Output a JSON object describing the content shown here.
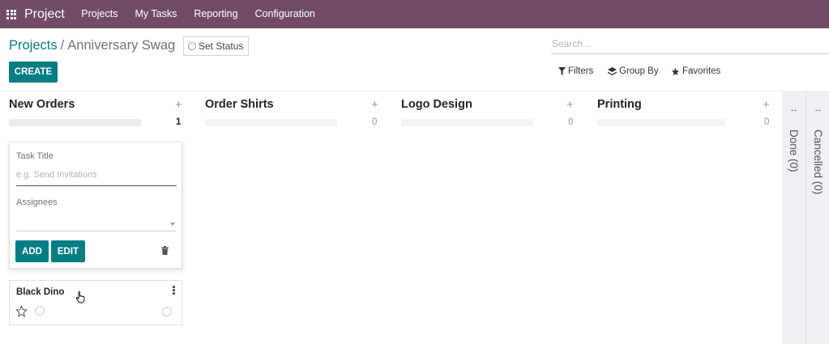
{
  "topbar": {
    "apps_icon": "grid-icon",
    "brand": "Project",
    "menu": [
      "Projects",
      "My Tasks",
      "Reporting",
      "Configuration"
    ]
  },
  "breadcrumb": {
    "parent": "Projects",
    "separator": "/",
    "current": "Anniversary Swag"
  },
  "set_status": {
    "label": "Set Status"
  },
  "search": {
    "placeholder": "Search..."
  },
  "create_button": "CREATE",
  "filters": {
    "filters_label": "Filters",
    "group_by_label": "Group By",
    "favorites_label": "Favorites"
  },
  "columns": [
    {
      "name": "New Orders",
      "count": "1"
    },
    {
      "name": "Order Shirts",
      "count": "0"
    },
    {
      "name": "Logo Design",
      "count": "0"
    },
    {
      "name": "Printing",
      "count": "0"
    }
  ],
  "folded_columns": [
    "Done (0)",
    "Cancelled (0)"
  ],
  "quick_create": {
    "task_title_label": "Task Title",
    "task_title_placeholder": "e.g. Send Invitations",
    "assignees_label": "Assignees",
    "add_label": "ADD",
    "edit_label": "EDIT"
  },
  "card": {
    "title": "Black Dino"
  },
  "colors": {
    "topbar": "#714b67",
    "primary": "#017e84"
  }
}
